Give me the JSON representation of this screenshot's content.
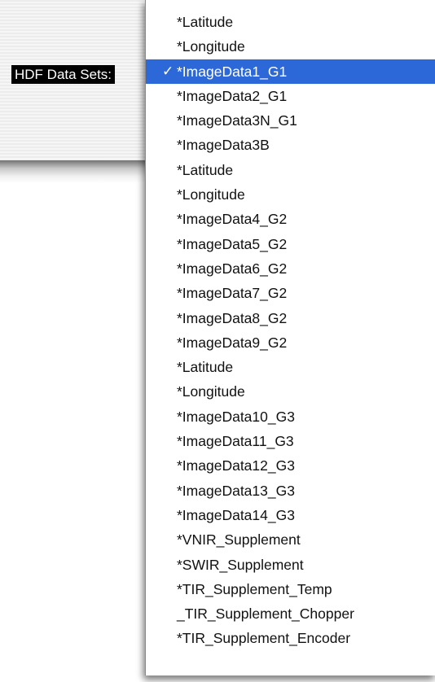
{
  "dialog": {
    "label": "HDF Data Sets:"
  },
  "menu": {
    "checkmark": "✓",
    "selected_index": 2,
    "selection_color": "#2d68d8",
    "items": [
      "*Latitude",
      "*Longitude",
      "*ImageData1_G1",
      "*ImageData2_G1",
      "*ImageData3N_G1",
      "*ImageData3B",
      "*Latitude",
      "*Longitude",
      "*ImageData4_G2",
      "*ImageData5_G2",
      "*ImageData6_G2",
      "*ImageData7_G2",
      "*ImageData8_G2",
      "*ImageData9_G2",
      "*Latitude",
      "*Longitude",
      "*ImageData10_G3",
      "*ImageData11_G3",
      "*ImageData12_G3",
      "*ImageData13_G3",
      "*ImageData14_G3",
      "*VNIR_Supplement",
      "*SWIR_Supplement",
      "*TIR_Supplement_Temp",
      "_TIR_Supplement_Chopper",
      "*TIR_Supplement_Encoder"
    ]
  }
}
